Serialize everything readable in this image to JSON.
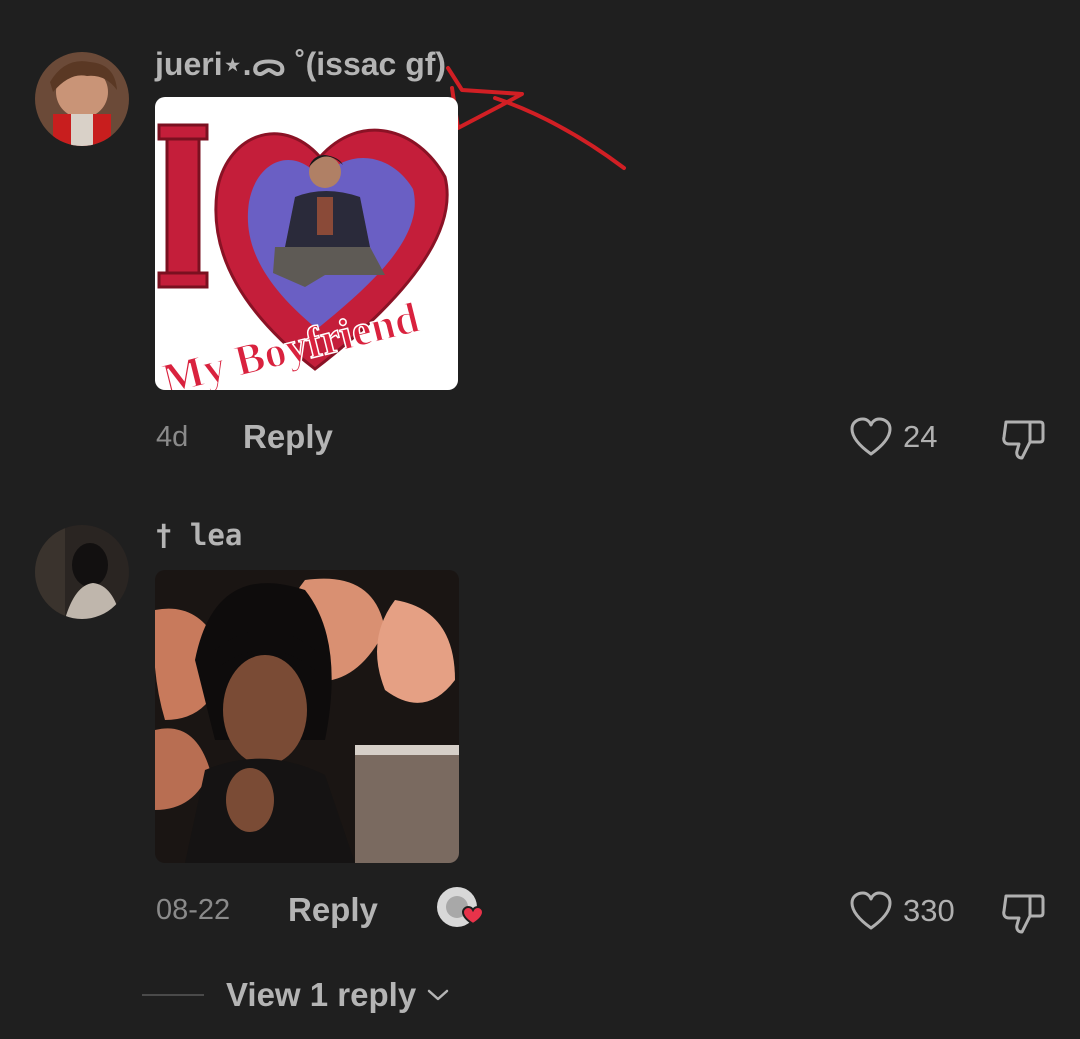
{
  "comments": [
    {
      "username": "jueri⋆.ᯅ ˚(issac gf)",
      "sticker_caption_left": "I",
      "sticker_caption_bottom": "My Boyfriend",
      "date": "4d",
      "reply_label": "Reply",
      "likes": "24"
    },
    {
      "username": "† lea",
      "date": "08-22",
      "reply_label": "Reply",
      "likes": "330"
    }
  ],
  "view_replies_label": "View 1 reply",
  "colors": {
    "background": "#1f1f1f",
    "text_primary": "#b4b4b4",
    "text_secondary": "#8a8a8a",
    "annotation_red": "#d11f24",
    "heart_badge": "#e8334a"
  },
  "icons": [
    "heart-outline-icon",
    "thumb-down-icon",
    "chevron-down-icon",
    "creator-liked-badge-icon"
  ]
}
